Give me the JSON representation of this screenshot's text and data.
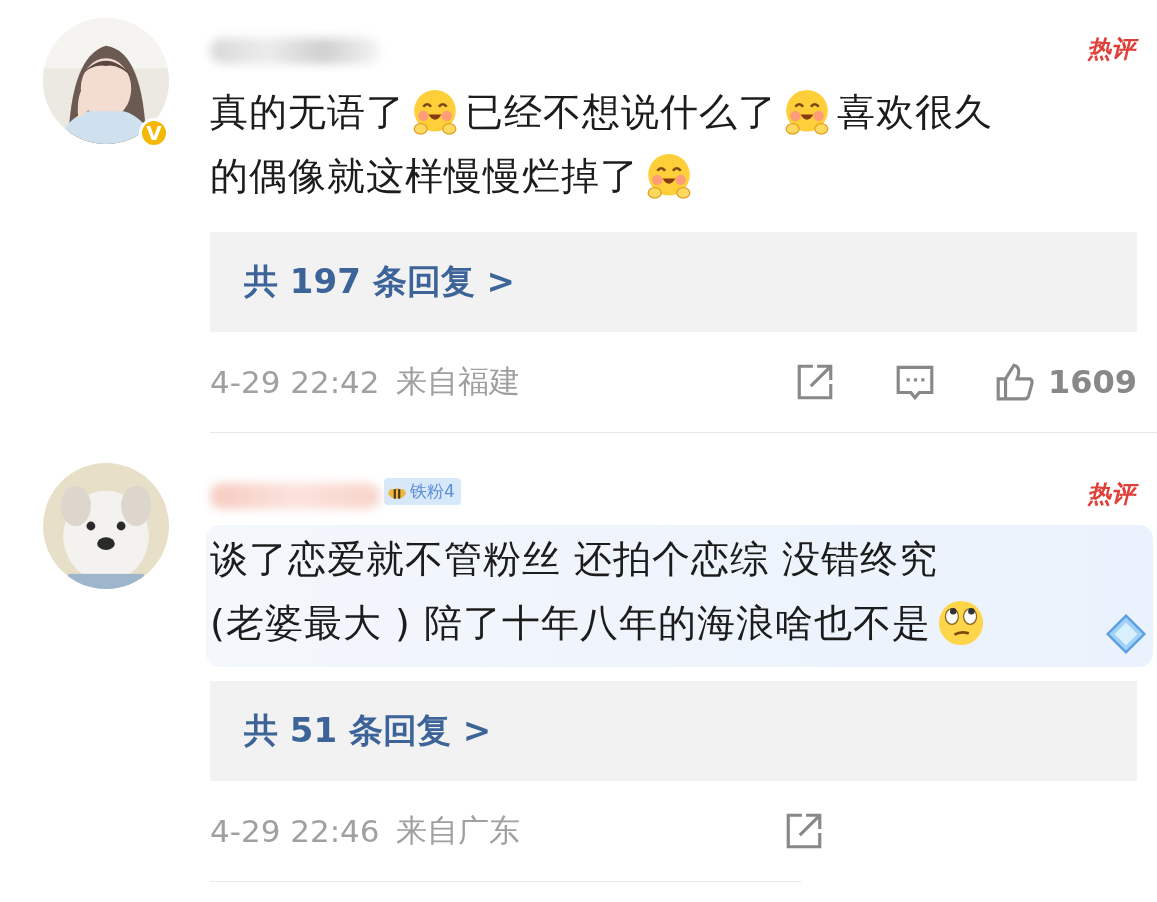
{
  "comments": [
    {
      "avatar": {
        "kind": "picture",
        "verified_badge": "V"
      },
      "hot_label": "热评",
      "highlighted": false,
      "lines": [
        [
          {
            "kind": "text",
            "text": "真的无语了"
          },
          {
            "kind": "grin"
          },
          {
            "kind": "text",
            "text": "已经不想说什么了"
          },
          {
            "kind": "grin"
          },
          {
            "kind": "text",
            "text": "喜欢很久"
          }
        ],
        [
          {
            "kind": "text",
            "text": "的偶像就这样慢慢烂掉了"
          },
          {
            "kind": "grin"
          }
        ]
      ],
      "replies": "共 197 条回复 >",
      "time": "4-29 22:42",
      "location": "来自福建",
      "actions": [
        {
          "kind": "share"
        },
        {
          "kind": "comment"
        },
        {
          "kind": "like",
          "count": "1609"
        }
      ],
      "divider_full_width": true
    },
    {
      "avatar": {
        "kind": "picture"
      },
      "fan_badge": "铁粉4",
      "hot_label": "热评",
      "highlighted": true,
      "lines": [
        [
          {
            "kind": "text",
            "text": "谈了恋爱就不管粉丝 还拍个恋综 没错终究"
          }
        ],
        [
          {
            "kind": "text",
            "text": "(老婆最大 ) 陪了十年八年的海浪啥也不是"
          },
          {
            "kind": "eyeroll"
          }
        ]
      ],
      "replies": "共 51 条回复 >",
      "time": "4-29 22:46",
      "location": "来自广东",
      "actions": [
        {
          "kind": "share"
        }
      ],
      "divider_full_width": false
    }
  ]
}
